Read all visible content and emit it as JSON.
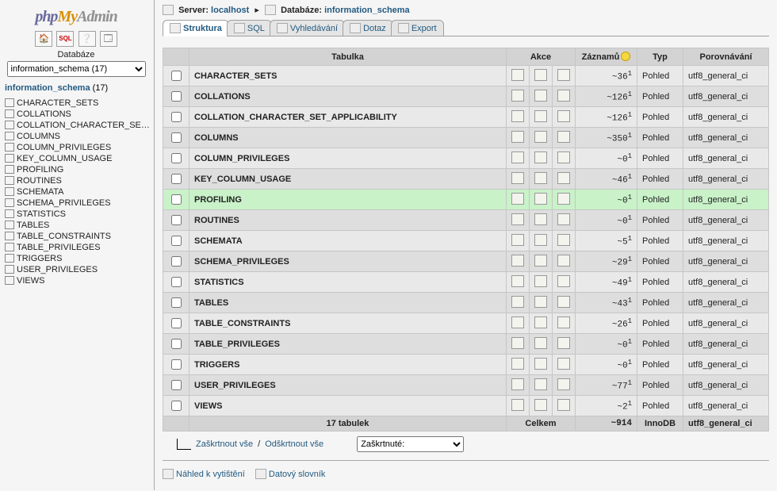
{
  "logo": {
    "php": "php",
    "my": "My",
    "admin": "Admin"
  },
  "sidebar": {
    "caption": "Databáze",
    "select_value": "information_schema (17)",
    "heading_db": "information_schema",
    "heading_count": "(17)",
    "items": [
      "CHARACTER_SETS",
      "COLLATIONS",
      "COLLATION_CHARACTER_SET_APP",
      "COLUMNS",
      "COLUMN_PRIVILEGES",
      "KEY_COLUMN_USAGE",
      "PROFILING",
      "ROUTINES",
      "SCHEMATA",
      "SCHEMA_PRIVILEGES",
      "STATISTICS",
      "TABLES",
      "TABLE_CONSTRAINTS",
      "TABLE_PRIVILEGES",
      "TRIGGERS",
      "USER_PRIVILEGES",
      "VIEWS"
    ]
  },
  "breadcrumb": {
    "server_label": "Server:",
    "server_name": "localhost",
    "db_label": "Databáze:",
    "db_name": "information_schema"
  },
  "tabs": [
    {
      "label": "Struktura",
      "icon": "structure-icon",
      "active": true
    },
    {
      "label": "SQL",
      "icon": "sql-icon",
      "active": false
    },
    {
      "label": "Vyhledávání",
      "icon": "search-icon",
      "active": false
    },
    {
      "label": "Dotaz",
      "icon": "query-icon",
      "active": false
    },
    {
      "label": "Export",
      "icon": "export-icon",
      "active": false
    }
  ],
  "headers": {
    "table": "Tabulka",
    "action": "Akce",
    "records": "Záznamů",
    "type": "Typ",
    "collation": "Porovnávání"
  },
  "rows": [
    {
      "name": "CHARACTER_SETS",
      "records": "~36",
      "sup": "1",
      "type": "Pohled",
      "collation": "utf8_general_ci"
    },
    {
      "name": "COLLATIONS",
      "records": "~126",
      "sup": "1",
      "type": "Pohled",
      "collation": "utf8_general_ci"
    },
    {
      "name": "COLLATION_CHARACTER_SET_APPLICABILITY",
      "records": "~126",
      "sup": "1",
      "type": "Pohled",
      "collation": "utf8_general_ci"
    },
    {
      "name": "COLUMNS",
      "records": "~350",
      "sup": "1",
      "type": "Pohled",
      "collation": "utf8_general_ci"
    },
    {
      "name": "COLUMN_PRIVILEGES",
      "records": "~0",
      "sup": "1",
      "type": "Pohled",
      "collation": "utf8_general_ci"
    },
    {
      "name": "KEY_COLUMN_USAGE",
      "records": "~46",
      "sup": "1",
      "type": "Pohled",
      "collation": "utf8_general_ci"
    },
    {
      "name": "PROFILING",
      "records": "~0",
      "sup": "1",
      "type": "Pohled",
      "collation": "utf8_general_ci",
      "highlight": true
    },
    {
      "name": "ROUTINES",
      "records": "~0",
      "sup": "1",
      "type": "Pohled",
      "collation": "utf8_general_ci"
    },
    {
      "name": "SCHEMATA",
      "records": "~5",
      "sup": "1",
      "type": "Pohled",
      "collation": "utf8_general_ci"
    },
    {
      "name": "SCHEMA_PRIVILEGES",
      "records": "~29",
      "sup": "1",
      "type": "Pohled",
      "collation": "utf8_general_ci"
    },
    {
      "name": "STATISTICS",
      "records": "~49",
      "sup": "1",
      "type": "Pohled",
      "collation": "utf8_general_ci"
    },
    {
      "name": "TABLES",
      "records": "~43",
      "sup": "1",
      "type": "Pohled",
      "collation": "utf8_general_ci"
    },
    {
      "name": "TABLE_CONSTRAINTS",
      "records": "~26",
      "sup": "1",
      "type": "Pohled",
      "collation": "utf8_general_ci"
    },
    {
      "name": "TABLE_PRIVILEGES",
      "records": "~0",
      "sup": "1",
      "type": "Pohled",
      "collation": "utf8_general_ci"
    },
    {
      "name": "TRIGGERS",
      "records": "~0",
      "sup": "1",
      "type": "Pohled",
      "collation": "utf8_general_ci"
    },
    {
      "name": "USER_PRIVILEGES",
      "records": "~77",
      "sup": "1",
      "type": "Pohled",
      "collation": "utf8_general_ci"
    },
    {
      "name": "VIEWS",
      "records": "~2",
      "sup": "1",
      "type": "Pohled",
      "collation": "utf8_general_ci"
    }
  ],
  "total_row": {
    "tables": "17 tabulek",
    "label": "Celkem",
    "records": "~914",
    "type": "InnoDB",
    "collation": "utf8_general_ci"
  },
  "checkall": {
    "check_all": "Zaškrtnout vše",
    "sep": " / ",
    "uncheck_all": "Odškrtnout vše",
    "dropdown_label": "Zaškrtnuté:"
  },
  "footer": {
    "print_view": "Náhled k vytištění",
    "data_dict": "Datový slovník"
  },
  "action_icons": [
    "browse-icon",
    "structure-icon",
    "search-row-icon"
  ]
}
